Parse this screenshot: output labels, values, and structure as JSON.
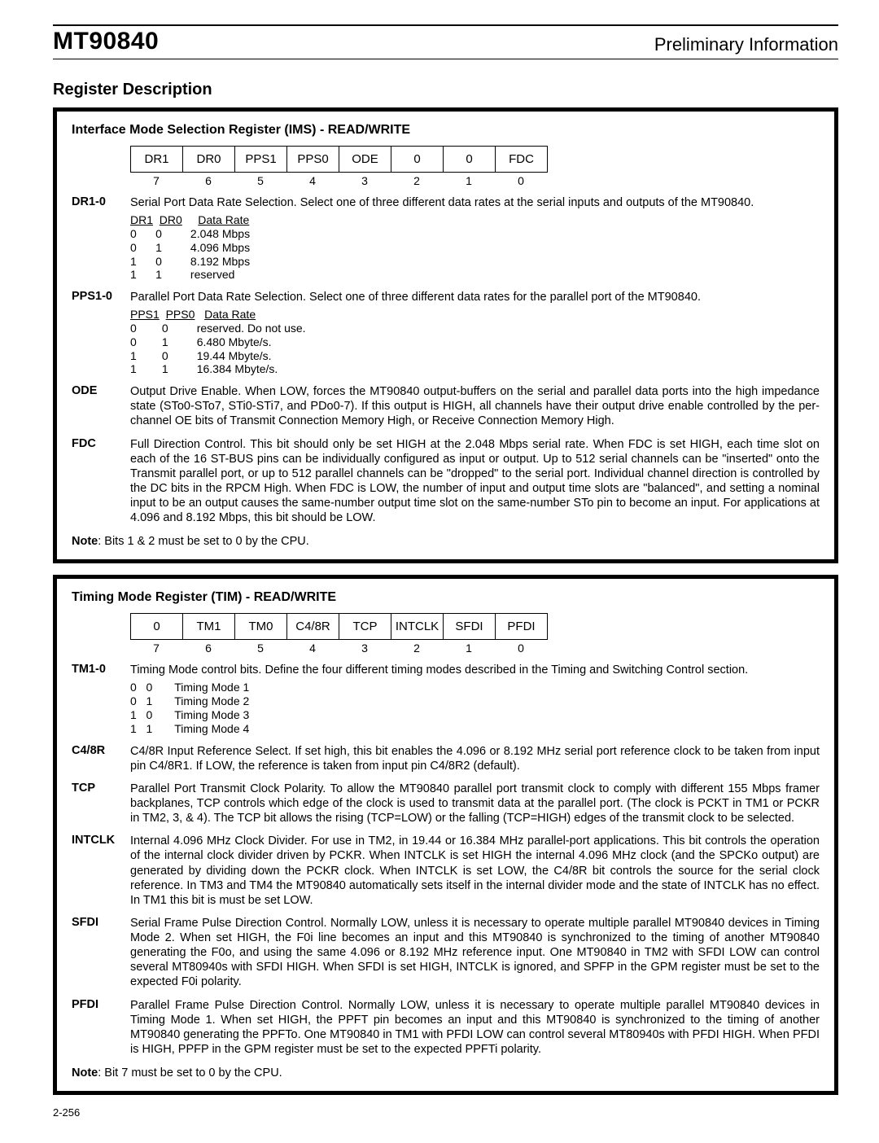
{
  "header": {
    "part_number": "MT90840",
    "right_text": "Preliminary Information"
  },
  "section_title": "Register Description",
  "register1": {
    "title": "Interface Mode Selection Register (IMS) - READ/WRITE",
    "bits": [
      "DR1",
      "DR0",
      "PPS1",
      "PPS0",
      "ODE",
      "0",
      "0",
      "FDC"
    ],
    "bit_nums": [
      "7",
      "6",
      "5",
      "4",
      "3",
      "2",
      "1",
      "0"
    ],
    "dr10_label": "DR1-0",
    "dr10_desc": "Serial Port Data Rate Selection. Select one of three different data rates at the serial inputs and outputs of the MT90840.",
    "dr_table_hdr_1": "DR1",
    "dr_table_hdr_2": "DR0",
    "dr_table_hdr_3": "Data Rate",
    "dr_r0": "0      0         2.048 Mbps",
    "dr_r1": "0      1         4.096 Mbps",
    "dr_r2": "1      0         8.192 Mbps",
    "dr_r3": "1      1         reserved",
    "pps10_label": "PPS1-0",
    "pps10_desc": "Parallel Port Data Rate Selection. Select one of three different data rates for the parallel port of the MT90840.",
    "pps_table_hdr_1": "PPS1",
    "pps_table_hdr_2": "PPS0",
    "pps_table_hdr_3": "Data Rate",
    "pps_r0": "0        0         reserved. Do not use.",
    "pps_r1": "0        1         6.480 Mbyte/s.",
    "pps_r2": "1        0         19.44 Mbyte/s.",
    "pps_r3": "1        1         16.384 Mbyte/s.",
    "ode_label": "ODE",
    "ode_desc": "Output Drive Enable. When LOW, forces the MT90840 output-buffers on the serial and parallel data ports into the high impedance state (STo0-STo7, STi0-STi7, and PDo0-7). If this output is HIGH, all channels have their output drive enable controlled by the per-channel OE bits of Transmit Connection Memory High, or Receive Connection Memory High.",
    "fdc_label": "FDC",
    "fdc_desc": "Full Direction Control. This bit should only be set HIGH at the 2.048 Mbps serial rate. When FDC is set HIGH, each time slot on each of the 16 ST-BUS pins can be individually configured as input or output. Up to 512 serial channels can be \"inserted\" onto the Transmit parallel port, or up to 512 parallel channels can be \"dropped\" to the serial port. Individual channel direction is controlled by the DC bits in the RPCM High. When FDC is LOW, the number of input and output time slots are \"balanced\", and setting a nominal input to be an output causes the same-number output time slot on the same-number STo pin to become an input. For applications at 4.096 and 8.192 Mbps, this bit should be LOW.",
    "note_prefix": "Note",
    "note_text": ": Bits 1 & 2 must be set to 0 by the CPU."
  },
  "register2": {
    "title": "Timing Mode Register (TIM) - READ/WRITE",
    "bits": [
      "0",
      "TM1",
      "TM0",
      "C4/8R",
      "TCP",
      "INTCLK",
      "SFDI",
      "PFDI"
    ],
    "bit_nums": [
      "7",
      "6",
      "5",
      "4",
      "3",
      "2",
      "1",
      "0"
    ],
    "tm_label": "TM1-0",
    "tm_desc": "Timing Mode control bits. Define the four different timing modes described in the Timing and Switching Control section.",
    "tm_r0": "0   0       Timing Mode 1",
    "tm_r1": "0   1       Timing Mode 2",
    "tm_r2": "1   0       Timing Mode 3",
    "tm_r3": "1   1       Timing Mode 4",
    "c48r_label": "C4/8R",
    "c48r_desc": "C4/8R Input Reference Select. If set high, this bit enables the 4.096 or 8.192 MHz serial port reference clock to be taken from input pin C4/8R1. If LOW, the reference is taken from input pin C4/8R2 (default).",
    "tcp_label": "TCP",
    "tcp_desc": "Parallel Port Transmit Clock Polarity. To allow the MT90840 parallel port transmit clock to comply with different 155 Mbps framer backplanes, TCP controls which edge of the clock is used to transmit data at the parallel port. (The clock is PCKT in TM1 or PCKR in TM2, 3, & 4). The TCP bit allows the rising (TCP=LOW) or the falling (TCP=HIGH) edges of the transmit clock to be selected.",
    "intclk_label": "INTCLK",
    "intclk_desc": "Internal 4.096 MHz Clock Divider. For use in TM2, in 19.44 or 16.384 MHz parallel-port applications. This bit controls the operation of the internal clock divider driven by PCKR. When INTCLK is set HIGH the internal 4.096 MHz clock (and the SPCKo output) are generated by dividing down the PCKR clock. When INTCLK is set LOW, the C4/8R bit controls the source for the serial clock reference. In TM3 and TM4 the MT90840 automatically sets itself in the internal divider mode and the state of INTCLK has no effect. In TM1 this bit is must be set LOW.",
    "sfdi_label": "SFDI",
    "sfdi_desc": "Serial Frame Pulse Direction Control. Normally LOW, unless it is necessary to operate multiple parallel MT90840 devices in Timing Mode 2. When set HIGH, the F0i line becomes an input and this MT90840 is synchronized to the timing of another MT90840 generating the F0o, and using the same 4.096 or 8.192 MHz reference input. One MT90840 in TM2 with SFDI LOW can control several MT80940s with SFDI HIGH. When SFDI is set HIGH, INTCLK is ignored, and SPFP in the GPM register must be set to the expected F0i polarity.",
    "pfdi_label": "PFDI",
    "pfdi_desc": "Parallel Frame Pulse Direction Control. Normally LOW, unless it is necessary to operate multiple parallel MT90840 devices in Timing Mode 1. When set HIGH, the PPFT pin becomes an input and this MT90840 is synchronized to the timing of another MT90840 generating the PPFTo. One MT90840 in TM1 with PFDI LOW can control several MT80940s with PFDI HIGH. When PFDI is HIGH, PPFP in the GPM register must be set to the expected PPFTi polarity.",
    "note_prefix": "Note",
    "note_text": ": Bit 7 must be set to 0 by the CPU."
  },
  "page_number": "2-256"
}
